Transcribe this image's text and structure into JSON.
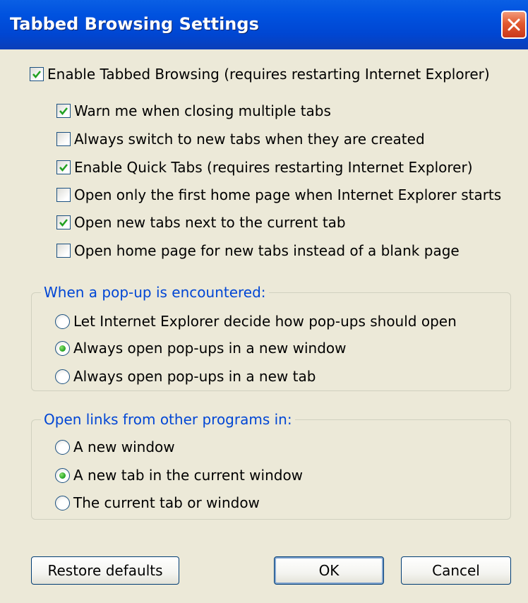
{
  "window": {
    "title": "Tabbed Browsing Settings"
  },
  "options": {
    "enable_tabbed": {
      "label": "Enable Tabbed Browsing (requires restarting Internet Explorer)",
      "checked": true
    },
    "items": [
      {
        "label": "Warn me when closing multiple tabs",
        "checked": true
      },
      {
        "label": "Always switch to new tabs when they are created",
        "checked": false
      },
      {
        "label": "Enable Quick Tabs (requires restarting Internet Explorer)",
        "checked": true
      },
      {
        "label": "Open only the first home page when Internet Explorer starts",
        "checked": false
      },
      {
        "label": "Open new tabs next to the current tab",
        "checked": true
      },
      {
        "label": "Open home page for new tabs instead of a blank page",
        "checked": false
      }
    ]
  },
  "popup_group": {
    "legend": "When a pop-up is encountered:",
    "options": [
      {
        "label": "Let Internet Explorer decide how pop-ups should open",
        "selected": false
      },
      {
        "label": "Always open pop-ups in a new window",
        "selected": true
      },
      {
        "label": "Always open pop-ups in a new tab",
        "selected": false
      }
    ]
  },
  "links_group": {
    "legend": "Open links from other programs in:",
    "options": [
      {
        "label": "A new window",
        "selected": false
      },
      {
        "label": "A new tab in the current window",
        "selected": true
      },
      {
        "label": "The current tab or window",
        "selected": false
      }
    ]
  },
  "buttons": {
    "restore": "Restore defaults",
    "ok": "OK",
    "cancel": "Cancel"
  }
}
